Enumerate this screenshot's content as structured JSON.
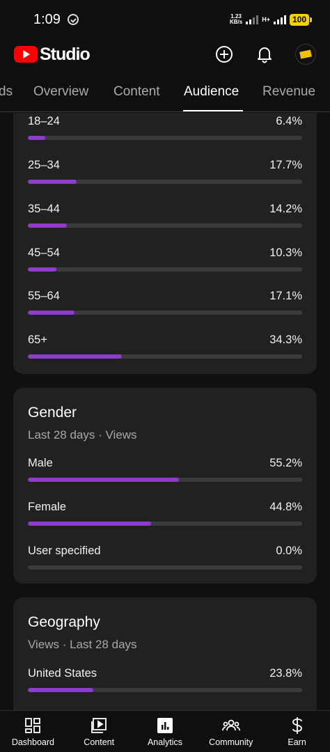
{
  "status_bar": {
    "time": "1:09",
    "net_speed_top": "1.23",
    "net_speed_bottom": "KB/s",
    "network_type": "H+",
    "battery": "100"
  },
  "app_bar": {
    "brand": "Studio",
    "icons": [
      "add-icon",
      "bell-icon",
      "avatar"
    ]
  },
  "tabs": [
    {
      "label": "ds",
      "active": false
    },
    {
      "label": "Overview",
      "active": false
    },
    {
      "label": "Content",
      "active": false
    },
    {
      "label": "Audience",
      "active": true
    },
    {
      "label": "Revenue",
      "active": false
    }
  ],
  "age": {
    "rows": [
      {
        "label": "18–24",
        "value": "6.4%",
        "percent": 6.4
      },
      {
        "label": "25–34",
        "value": "17.7%",
        "percent": 17.7
      },
      {
        "label": "35–44",
        "value": "14.2%",
        "percent": 14.2
      },
      {
        "label": "45–54",
        "value": "10.3%",
        "percent": 10.3
      },
      {
        "label": "55–64",
        "value": "17.1%",
        "percent": 17.1
      },
      {
        "label": "65+",
        "value": "34.3%",
        "percent": 34.3
      }
    ]
  },
  "gender": {
    "title": "Gender",
    "subtitle": "Last 28 days · Views",
    "rows": [
      {
        "label": "Male",
        "value": "55.2%",
        "percent": 55.2
      },
      {
        "label": "Female",
        "value": "44.8%",
        "percent": 44.8
      },
      {
        "label": "User specified",
        "value": "0.0%",
        "percent": 0.0
      }
    ]
  },
  "geography": {
    "title": "Geography",
    "subtitle": "Views · Last 28 days",
    "rows": [
      {
        "label": "United States",
        "value": "23.8%",
        "percent": 23.8
      }
    ]
  },
  "bottom_nav": [
    {
      "label": "Dashboard",
      "icon": "dashboard-icon"
    },
    {
      "label": "Content",
      "icon": "content-icon"
    },
    {
      "label": "Analytics",
      "icon": "analytics-icon"
    },
    {
      "label": "Community",
      "icon": "community-icon"
    },
    {
      "label": "Earn",
      "icon": "earn-icon"
    }
  ],
  "colors": {
    "bar_fill": "#8e3ccb",
    "bar_track": "#3a3a3a",
    "card_bg": "#212121",
    "background": "#0f0f0f",
    "brand_red": "#ff0000",
    "battery_yellow": "#f5d000"
  }
}
